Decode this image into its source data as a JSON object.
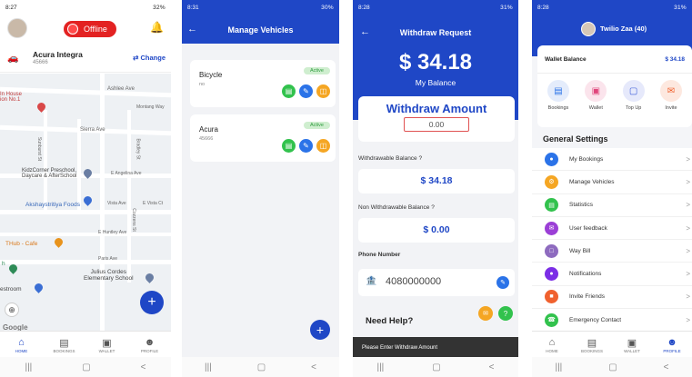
{
  "screen1": {
    "status": {
      "time": "8:27",
      "right": "32%"
    },
    "offline_label": "Offline",
    "vehicle": {
      "name": "Acura Integra",
      "plate": "45666"
    },
    "change_label": "Change",
    "map": {
      "streets": [
        "Ashlee Ave",
        "Montang Way",
        "Sierra Ave",
        "Sunburst St",
        "Bradley St",
        "E Angelina Ave",
        "Vista Ave",
        "E Vista Ct",
        "E Huntley Ave",
        "Paris Ave",
        "Cozzens St"
      ],
      "pois": {
        "in_house": "In House\nion No.1",
        "kidz": "KidzCorner Preschool,\nDaycare & AfterSchool",
        "akshay": "Akshaystritiya Foods",
        "thub": "THub - Cafe",
        "julius": "Julius Cordes\nElementary School",
        "restroom": "estroom",
        "h": "h"
      },
      "google": "Google"
    },
    "tabs": [
      "HOME",
      "BOOKINGS",
      "WALLET",
      "PROFILE"
    ]
  },
  "screen2": {
    "status": {
      "time": "8:31",
      "right": "30%"
    },
    "title": "Manage Vehicles",
    "vehicles": [
      {
        "name": "Bicycle",
        "plate": "no",
        "status": "Active"
      },
      {
        "name": "Acura",
        "plate": "45666",
        "status": "Active"
      }
    ]
  },
  "screen3": {
    "status": {
      "time": "8:28",
      "right": "31%"
    },
    "title": "Withdraw Request",
    "balance": "$ 34.18",
    "balance_label": "My Balance",
    "withdraw_title": "Withdraw Amount",
    "withdraw_value": "0.00",
    "withdrawable_label": "Withdrawable Balance",
    "withdrawable_value": "$ 34.18",
    "non_withdrawable_label": "Non Withdrawable Balance",
    "non_withdrawable_value": "$ 0.00",
    "phone_label": "Phone Number",
    "phone_value": "4080000000",
    "help": "Need Help?",
    "toast": "Please Enter Withdraw Amount"
  },
  "screen4": {
    "status": {
      "time": "8:28",
      "right": "31%"
    },
    "profile_name": "Twilio Zaa (40)",
    "wallet_label": "Wallet Balance",
    "wallet_value": "$ 34.18",
    "quick_actions": [
      {
        "label": "Bookings",
        "icon": "bookings-icon",
        "color": "#2b73e8"
      },
      {
        "label": "Wallet",
        "icon": "wallet-icon",
        "color": "#e0457b"
      },
      {
        "label": "Top Up",
        "icon": "topup-icon",
        "color": "#3b5bd9"
      },
      {
        "label": "Invite",
        "icon": "invite-icon",
        "color": "#f0612e"
      }
    ],
    "section_title": "General Settings",
    "settings": [
      {
        "label": "My Bookings",
        "color": "#2b73e8",
        "icon": "car-icon"
      },
      {
        "label": "Manage Vehicles",
        "color": "#f5a623",
        "icon": "gear-icon"
      },
      {
        "label": "Statistics",
        "color": "#32c24d",
        "icon": "chart-icon"
      },
      {
        "label": "User feedback",
        "color": "#9b3fd6",
        "icon": "feedback-icon"
      },
      {
        "label": "Way Bill",
        "color": "#8e6bbf",
        "icon": "waybill-icon"
      },
      {
        "label": "Notifications",
        "color": "#7b2ee6",
        "icon": "bell-icon"
      },
      {
        "label": "Invite Friends",
        "color": "#f0612e",
        "icon": "gift-icon"
      },
      {
        "label": "Emergency Contact",
        "color": "#32c24d",
        "icon": "phone-icon"
      }
    ],
    "tabs": [
      "HOME",
      "BOOKINGS",
      "WALLET",
      "PROFILE"
    ]
  }
}
